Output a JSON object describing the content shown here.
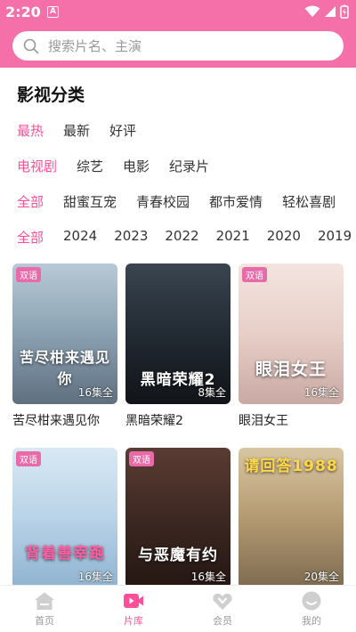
{
  "status_bar": {
    "time": "2:20",
    "notification_icon": "A"
  },
  "search": {
    "placeholder": "搜索片名、主演"
  },
  "section_title": "影视分类",
  "filters": {
    "sort": [
      "最热",
      "最新",
      "好评"
    ],
    "type": [
      "电视剧",
      "综艺",
      "电影",
      "纪录片"
    ],
    "genre": [
      "全部",
      "甜蜜互宠",
      "青春校园",
      "都市爱情",
      "轻松喜剧"
    ],
    "year": [
      "全部",
      "2024",
      "2023",
      "2022",
      "2021",
      "2020",
      "2019"
    ]
  },
  "cards": [
    {
      "title": "苦尽柑来遇见你",
      "badge": "双语",
      "episodes": "16集全",
      "poster_text": "苦尽柑来遇见你"
    },
    {
      "title": "黑暗荣耀2",
      "badge": "",
      "episodes": "8集全",
      "poster_text": "黑暗荣耀2"
    },
    {
      "title": "眼泪女王",
      "badge": "双语",
      "episodes": "16集全",
      "poster_text": "眼泪女王"
    },
    {
      "title": "",
      "badge": "双语",
      "episodes": "16集全",
      "poster_text": "背着善宰跑"
    },
    {
      "title": "",
      "badge": "双语",
      "episodes": "16集全",
      "poster_text": "与恶魔有约"
    },
    {
      "title": "",
      "badge": "",
      "episodes": "20集全",
      "poster_text": "请回答1988"
    }
  ],
  "tabbar": [
    {
      "label": "首页",
      "icon": "home-icon"
    },
    {
      "label": "片库",
      "icon": "video-library-icon"
    },
    {
      "label": "会员",
      "icon": "vip-icon"
    },
    {
      "label": "我的",
      "icon": "profile-icon"
    }
  ],
  "colors": {
    "brand_pink": "#f56fa8",
    "active_text": "#ff4f9a"
  }
}
